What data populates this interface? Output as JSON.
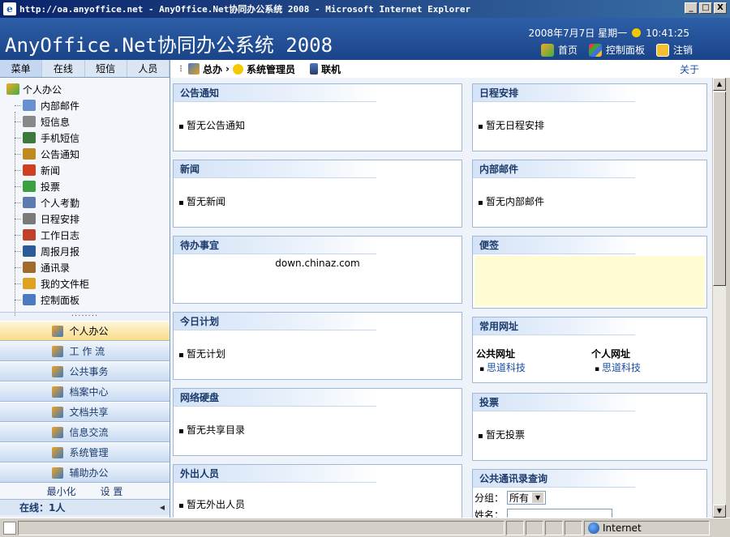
{
  "window": {
    "title": "http://oa.anyoffice.net - AnyOffice.Net协同办公系统 2008 - Microsoft Internet Explorer",
    "min": "_",
    "max": "□",
    "close": "X"
  },
  "header": {
    "app_title": "AnyOffice.Net协同办公系统 2008",
    "date": "2008年7月7日  星期一",
    "time": "10:41:25",
    "links": [
      {
        "label": "首页",
        "icon": "home-icon"
      },
      {
        "label": "控制面板",
        "icon": "control-panel-icon"
      },
      {
        "label": "注销",
        "icon": "logout-icon"
      }
    ]
  },
  "sidebar": {
    "tabs": [
      "菜单",
      "在线",
      "短信",
      "人员"
    ],
    "tree_root": "个人办公",
    "tree_items": [
      {
        "label": "内部邮件",
        "icon": "mail-icon",
        "color": "#6a8fd0"
      },
      {
        "label": "短信息",
        "icon": "sms-icon",
        "color": "#888888"
      },
      {
        "label": "手机短信",
        "icon": "mobile-icon",
        "color": "#3a7a3a"
      },
      {
        "label": "公告通知",
        "icon": "notice-icon",
        "color": "#c08a20"
      },
      {
        "label": "新闻",
        "icon": "news-icon",
        "color": "#d04020"
      },
      {
        "label": "投票",
        "icon": "vote-icon",
        "color": "#3aa040"
      },
      {
        "label": "个人考勤",
        "icon": "attendance-icon",
        "color": "#5a7ab0"
      },
      {
        "label": "日程安排",
        "icon": "calendar-icon",
        "color": "#7a7a7a"
      },
      {
        "label": "工作日志",
        "icon": "worklog-icon",
        "color": "#c0402a"
      },
      {
        "label": "周报月报",
        "icon": "report-icon",
        "color": "#2a5a9a"
      },
      {
        "label": "通讯录",
        "icon": "addressbook-icon",
        "color": "#a06a2a"
      },
      {
        "label": "我的文件柜",
        "icon": "folder-icon",
        "color": "#e0a020"
      },
      {
        "label": "控制面板",
        "icon": "control-panel-icon",
        "color": "#4a7ac0"
      }
    ],
    "modules": [
      {
        "label": "个人办公",
        "icon": "personal-office-icon",
        "active": true
      },
      {
        "label": "工 作 流",
        "icon": "workflow-icon",
        "active": false
      },
      {
        "label": "公共事务",
        "icon": "public-affairs-icon",
        "active": false
      },
      {
        "label": "档案中心",
        "icon": "archive-icon",
        "active": false
      },
      {
        "label": "文档共享",
        "icon": "document-share-icon",
        "active": false
      },
      {
        "label": "信息交流",
        "icon": "info-exchange-icon",
        "active": false
      },
      {
        "label": "系统管理",
        "icon": "system-admin-icon",
        "active": false
      },
      {
        "label": "辅助办公",
        "icon": "aux-office-icon",
        "active": false
      }
    ],
    "minimize": "最小化",
    "settings": "设 置",
    "online": "在线：1人"
  },
  "breadcrumb": {
    "item1": "总办",
    "sep": "›",
    "item2": "系统管理员",
    "item3": "联机",
    "about": "关于"
  },
  "panels": {
    "notice": {
      "title": "公告通知",
      "text": "暂无公告通知"
    },
    "schedule": {
      "title": "日程安排",
      "text": "暂无日程安排"
    },
    "news": {
      "title": "新闻",
      "text": "暂无新闻"
    },
    "mail": {
      "title": "内部邮件",
      "text": "暂无内部邮件"
    },
    "todo": {
      "title": "待办事宜",
      "text": "down.chinaz.com"
    },
    "memo": {
      "title": "便签"
    },
    "plan": {
      "title": "今日计划",
      "text": "暂无计划"
    },
    "links": {
      "title": "常用网址",
      "public_title": "公共网址",
      "public_item": "思道科技",
      "personal_title": "个人网址",
      "personal_item": "思道科技"
    },
    "disk": {
      "title": "网络硬盘",
      "text": "暂无共享目录"
    },
    "vote": {
      "title": "投票",
      "text": "暂无投票"
    },
    "out": {
      "title": "外出人员",
      "text": "暂无外出人员"
    },
    "contacts": {
      "title": "公共通讯录查询",
      "group_label": "分组：",
      "group_value": "所有",
      "name_label": "姓名："
    }
  },
  "statusbar": {
    "zone": "Internet"
  }
}
